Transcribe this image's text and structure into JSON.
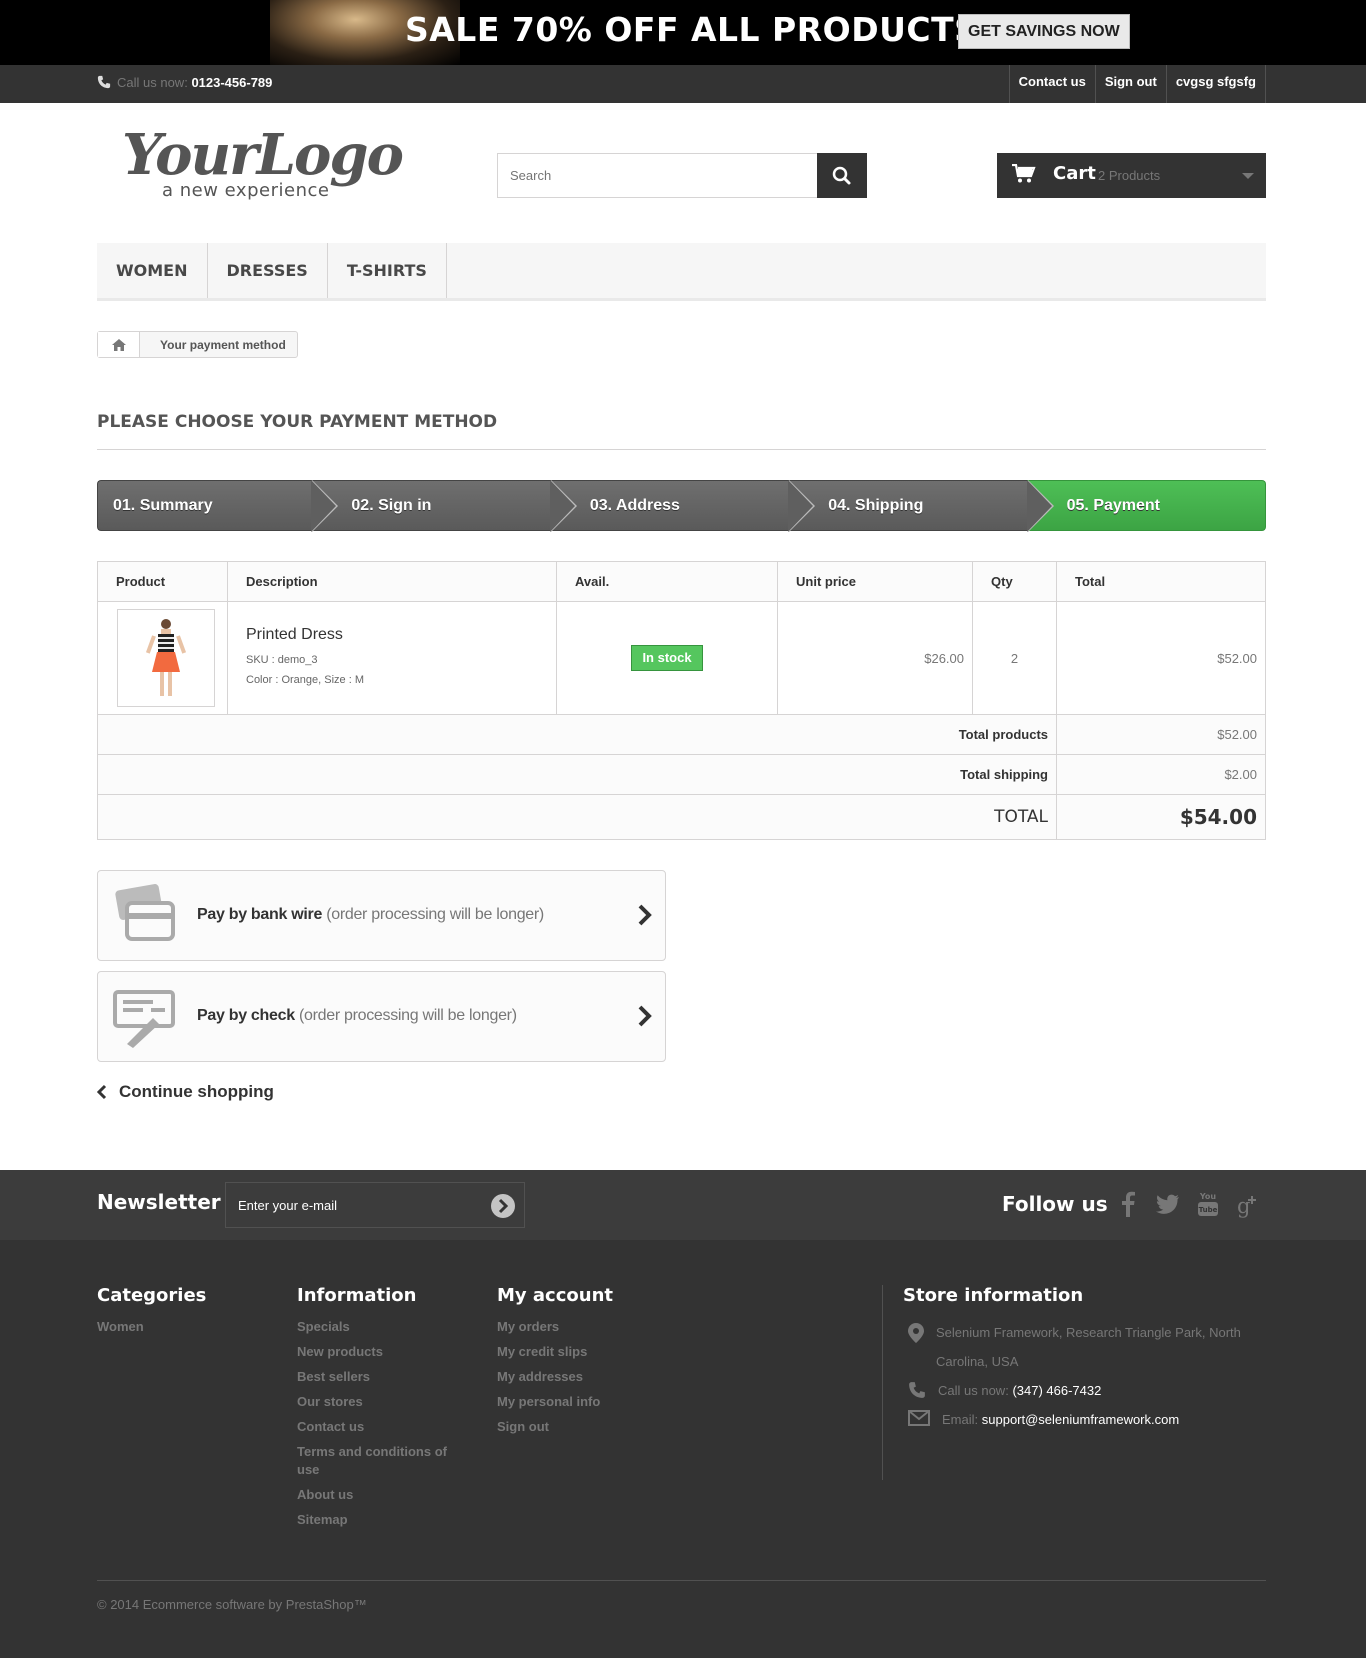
{
  "banner": {
    "headline": "SALE 70% OFF ALL PRODUCTS",
    "cta": "GET SAVINGS NOW"
  },
  "topbar": {
    "call_label": "Call us now:",
    "phone": "0123-456-789",
    "links": [
      "Contact us",
      "Sign out",
      "cvgsg sfgsfg"
    ]
  },
  "header": {
    "logo_main": "YourLogo",
    "logo_sub": "a new experience",
    "search_placeholder": "Search",
    "cart_label": "Cart",
    "cart_count": "2 Products"
  },
  "menu": [
    "WOMEN",
    "DRESSES",
    "T-SHIRTS"
  ],
  "breadcrumb": {
    "current": "Your payment method"
  },
  "page_title": "PLEASE CHOOSE YOUR PAYMENT METHOD",
  "steps": [
    "01. Summary",
    "02. Sign in",
    "03. Address",
    "04. Shipping",
    "05. Payment"
  ],
  "table": {
    "headers": [
      "Product",
      "Description",
      "Avail.",
      "Unit price",
      "Qty",
      "Total"
    ],
    "item": {
      "name": "Printed Dress",
      "sku": "SKU : demo_3",
      "attrs": "Color : Orange, Size : M",
      "availability": "In stock",
      "unit_price": "$26.00",
      "qty": "2",
      "total": "$52.00"
    },
    "total_products_label": "Total products",
    "total_products": "$52.00",
    "total_shipping_label": "Total shipping",
    "total_shipping": "$2.00",
    "total_label": "TOTAL",
    "total": "$54.00"
  },
  "payment": {
    "bankwire_main": "Pay by bank wire",
    "bankwire_note": "(order processing will be longer)",
    "check_main": "Pay by check",
    "check_note": "(order processing will be longer)"
  },
  "continue_label": "Continue shopping",
  "footer": {
    "newsletter_title": "Newsletter",
    "newsletter_placeholder": "Enter your e-mail",
    "follow_title": "Follow us",
    "categories_title": "Categories",
    "categories": [
      "Women"
    ],
    "information_title": "Information",
    "information": [
      "Specials",
      "New products",
      "Best sellers",
      "Our stores",
      "Contact us",
      "Terms and conditions of use",
      "About us",
      "Sitemap"
    ],
    "account_title": "My account",
    "account": [
      "My orders",
      "My credit slips",
      "My addresses",
      "My personal info",
      "Sign out"
    ],
    "store_title": "Store information",
    "store_address": "Selenium Framework, Research Triangle Park, North Carolina, USA",
    "store_call_label": "Call us now:",
    "store_phone": "(347) 466-7432",
    "store_email_label": "Email:",
    "store_email": "support@seleniumframework.com",
    "copyright": "© 2014 Ecommerce software by PrestaShop™"
  },
  "colors": {
    "accent_green": "#46a74e",
    "dark": "#333333",
    "step_gray": "#666666"
  },
  "icons": [
    "phone-icon",
    "search-icon",
    "cart-icon",
    "home-icon",
    "bankwire-icon",
    "check-icon",
    "chevron-right-icon",
    "chevron-left-icon",
    "facebook-icon",
    "twitter-icon",
    "youtube-icon",
    "googleplus-icon",
    "map-pin-icon",
    "envelope-icon"
  ]
}
